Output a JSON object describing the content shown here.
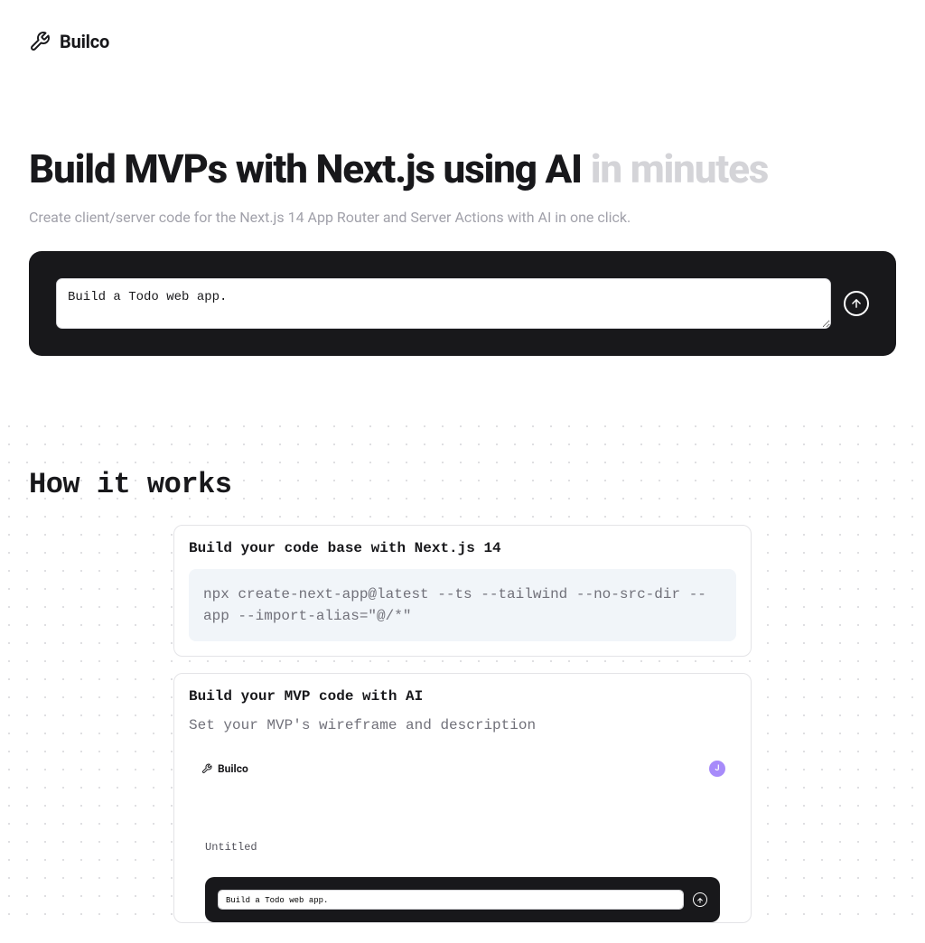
{
  "brand": "Builco",
  "hero": {
    "title_main": "Build MVPs with Next.js using AI ",
    "title_suffix": "in minutes",
    "subtitle": "Create client/server code for the Next.js 14 App Router and Server Actions with AI in one click."
  },
  "prompt": {
    "value": "Build a Todo web app."
  },
  "how_it_works": {
    "title": "How it works",
    "steps": [
      {
        "title": "Build your code base with Next.js 14",
        "code": "npx create-next-app@latest --ts --tailwind --no-src-dir --app --import-alias=\"@/*\""
      },
      {
        "title": "Build your MVP code with AI",
        "desc": "Set your MVP's wireframe and description",
        "preview": {
          "brand": "Builco",
          "avatar_initial": "J",
          "doc_title": "Untitled",
          "prompt_value": "Build a Todo web app."
        }
      }
    ]
  }
}
